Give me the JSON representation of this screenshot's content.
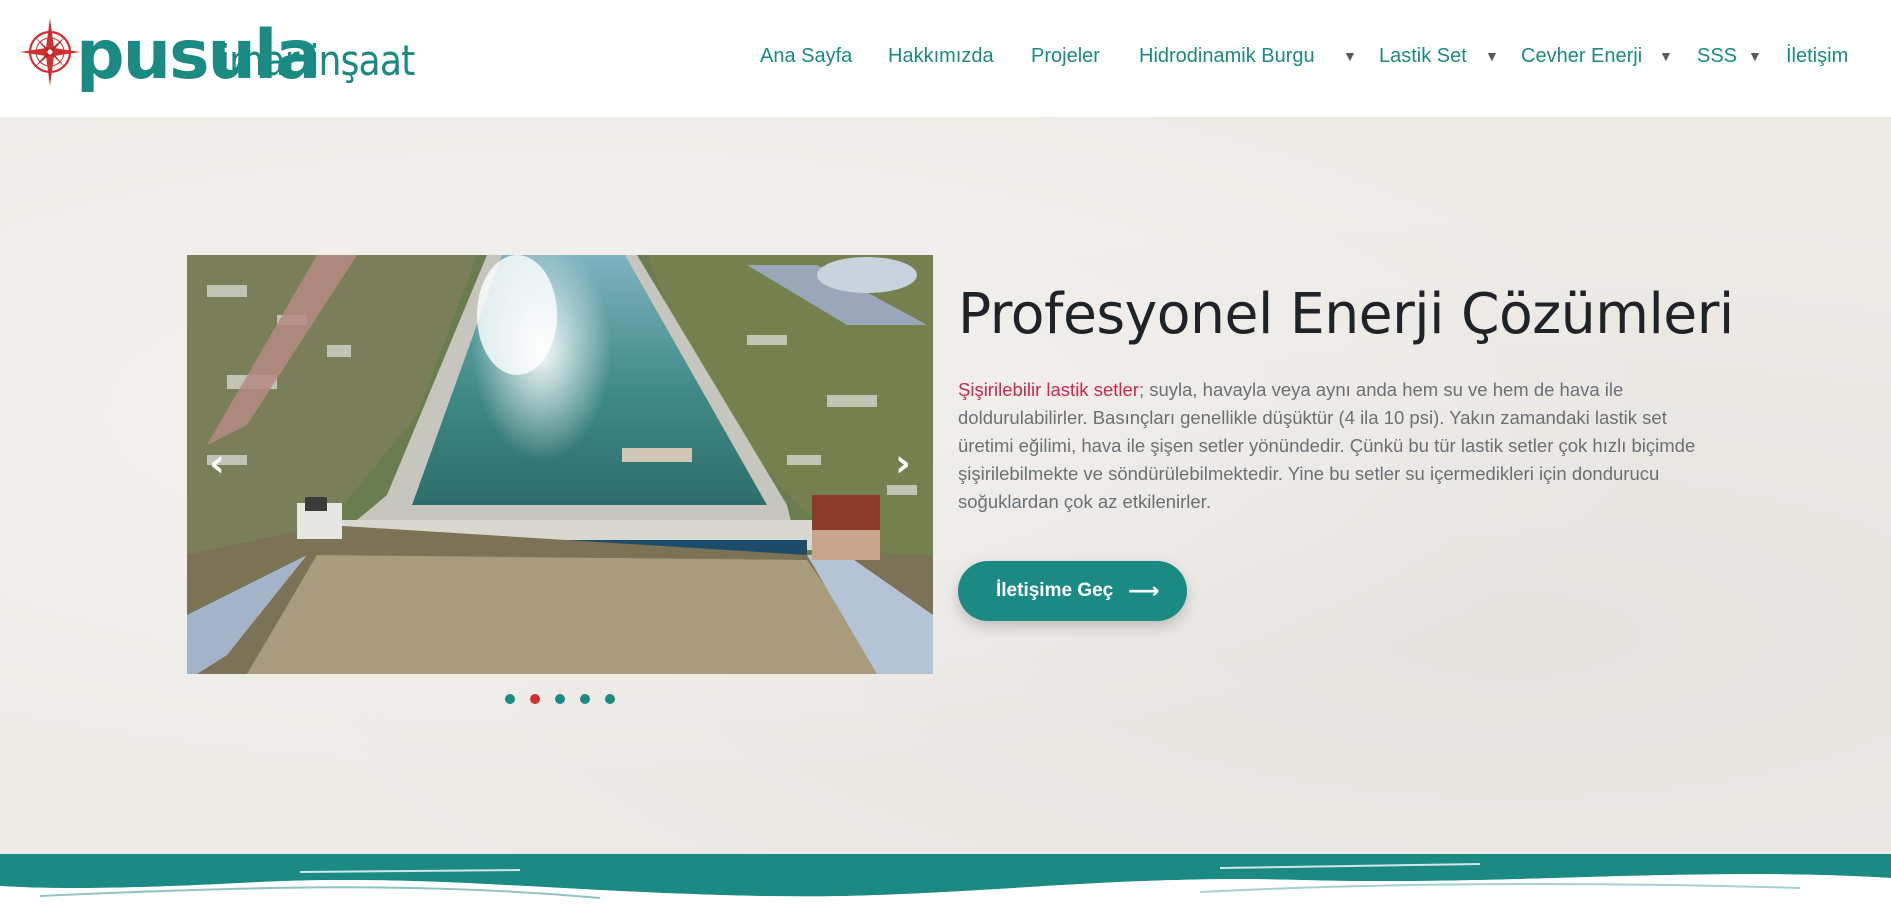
{
  "brand": {
    "name": "pusula",
    "tagline": "imar inşaat",
    "colors": {
      "primary": "#1b8a82",
      "accent": "#d0302f",
      "highlight": "#c9284e"
    }
  },
  "nav": {
    "items": [
      {
        "label": "Ana Sayfa",
        "has_dropdown": false
      },
      {
        "label": "Hakkımızda",
        "has_dropdown": false
      },
      {
        "label": "Projeler",
        "has_dropdown": false
      },
      {
        "label": "Hidrodinamik Burgu",
        "has_dropdown": true
      },
      {
        "label": "Lastik Set",
        "has_dropdown": true
      },
      {
        "label": "Cevher Enerji",
        "has_dropdown": true
      },
      {
        "label": "SSS",
        "has_dropdown": true
      },
      {
        "label": "İletişim",
        "has_dropdown": false
      }
    ],
    "caret_icon": "triangle-down-icon"
  },
  "slider": {
    "prev_icon": "chevron-left-icon",
    "next_icon": "chevron-right-icon",
    "slide_count": 5,
    "active_index": 1
  },
  "hero": {
    "title": "Profesyonel Enerji Çözümleri",
    "highlight": "Şişirilebilir lastik setler",
    "body": "; suyla, havayla veya aynı anda hem su ve hem de hava ile doldurulabilirler. Basınçları genellikle düşüktür (4 ila 10 psi). Yakın zamandaki lastik set üretimi eğilimi, hava ile şişen setler yönündedir. Çünkü bu tür lastik setler çok hızlı biçimde şişirilebilmekte ve söndürülebilmektedir. Yine bu setler su içermedikleri için dondurucu soğuklardan çok az etkilenirler.",
    "cta_label": "İletişime Geç",
    "cta_icon": "arrow-right-icon"
  }
}
